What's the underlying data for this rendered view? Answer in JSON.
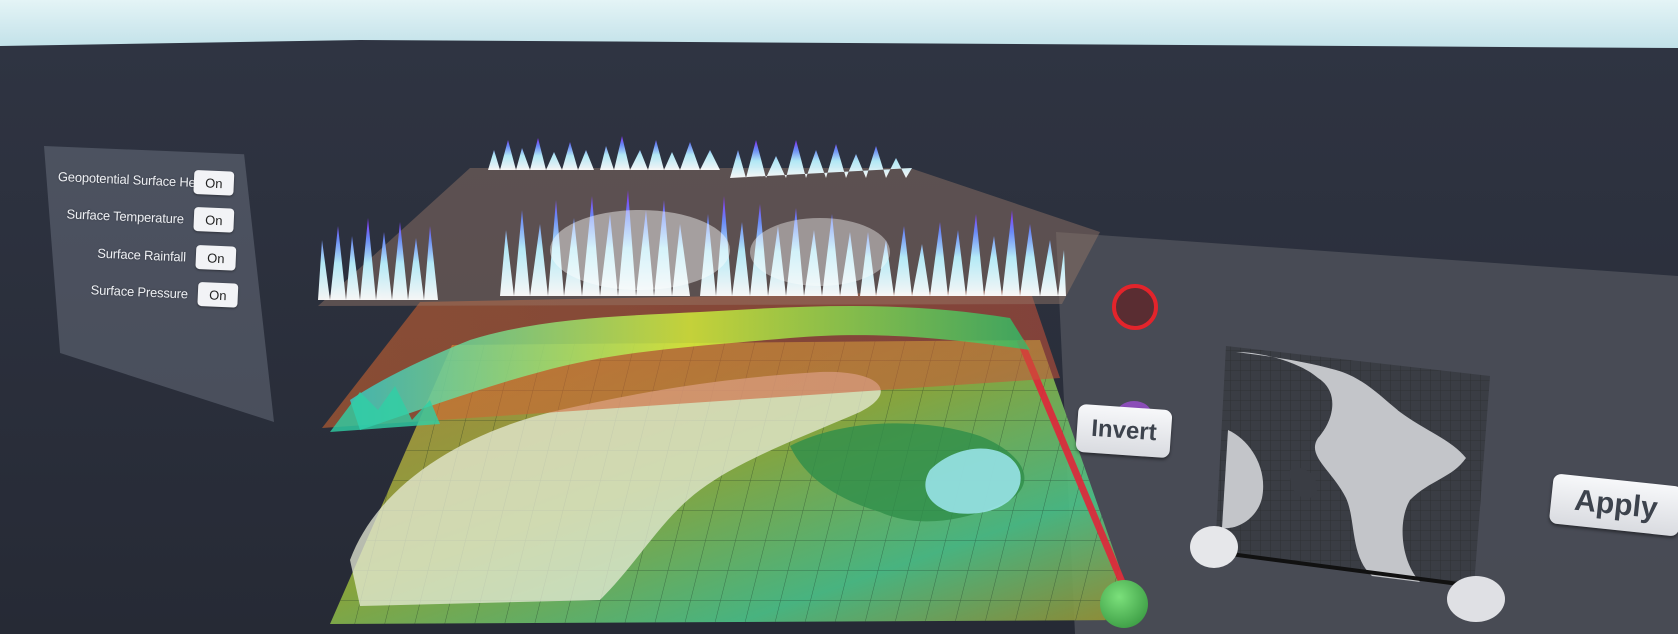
{
  "layers_panel": {
    "rows": [
      {
        "label": "Geopotential Surface Height",
        "toggle": "On"
      },
      {
        "label": "Surface Temperature",
        "toggle": "On"
      },
      {
        "label": "Surface Rainfall",
        "toggle": "On"
      },
      {
        "label": "Surface Pressure",
        "toggle": "On"
      }
    ]
  },
  "buttons": {
    "invert": "Invert",
    "apply": "Apply"
  },
  "colors": {
    "sky": "#cfe9ef",
    "room_wall": "#2d3240",
    "handle_red": "#e3242b",
    "handle_green": "#3fa14a",
    "map_panel": "#3a3d44"
  }
}
